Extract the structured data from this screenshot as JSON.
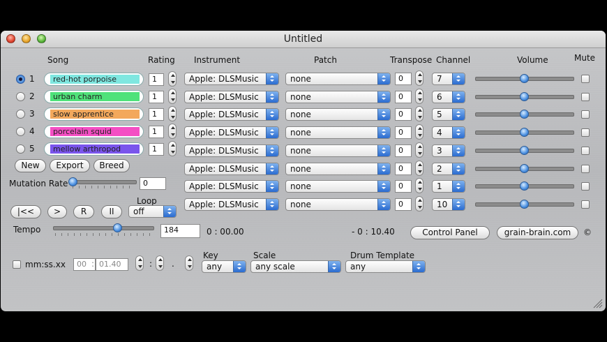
{
  "window": {
    "title": "Untitled"
  },
  "headers": {
    "song": "Song",
    "rating": "Rating",
    "instrument": "Instrument",
    "patch": "Patch",
    "transpose": "Transpose",
    "channel": "Channel",
    "volume": "Volume",
    "mute": "Mute"
  },
  "songs": [
    {
      "num": "1",
      "name": "red-hot porpoise",
      "color": "#7fe7e0",
      "rating": "1",
      "selected": true
    },
    {
      "num": "2",
      "name": "urban charm",
      "color": "#4fe27a",
      "rating": "1",
      "selected": false
    },
    {
      "num": "3",
      "name": "slow apprentice",
      "color": "#f3a85c",
      "rating": "1",
      "selected": false
    },
    {
      "num": "4",
      "name": "porcelain squid",
      "color": "#f44fc4",
      "rating": "1",
      "selected": false
    },
    {
      "num": "5",
      "name": "mellow arthropod",
      "color": "#7a55ec",
      "rating": "1",
      "selected": false
    }
  ],
  "tracks": [
    {
      "instrument": "Apple: DLSMusic",
      "patch": "none",
      "transpose": "0",
      "channel": "7",
      "volume": 0.5,
      "mute": false
    },
    {
      "instrument": "Apple: DLSMusic",
      "patch": "none",
      "transpose": "0",
      "channel": "6",
      "volume": 0.5,
      "mute": false
    },
    {
      "instrument": "Apple: DLSMusic",
      "patch": "none",
      "transpose": "0",
      "channel": "5",
      "volume": 0.5,
      "mute": false
    },
    {
      "instrument": "Apple: DLSMusic",
      "patch": "none",
      "transpose": "0",
      "channel": "4",
      "volume": 0.5,
      "mute": false
    },
    {
      "instrument": "Apple: DLSMusic",
      "patch": "none",
      "transpose": "0",
      "channel": "3",
      "volume": 0.5,
      "mute": false
    },
    {
      "instrument": "Apple: DLSMusic",
      "patch": "none",
      "transpose": "0",
      "channel": "2",
      "volume": 0.5,
      "mute": false
    },
    {
      "instrument": "Apple: DLSMusic",
      "patch": "none",
      "transpose": "0",
      "channel": "1",
      "volume": 0.5,
      "mute": false
    },
    {
      "instrument": "Apple: DLSMusic",
      "patch": "none",
      "transpose": "0",
      "channel": "10",
      "volume": 0.5,
      "mute": false
    }
  ],
  "buttons": {
    "new": "New",
    "export": "Export",
    "breed": "Breed",
    "rewind": "|<<",
    "play": ">",
    "record": "R",
    "pause": "II",
    "control_panel": "Control Panel",
    "website": "grain-brain.com",
    "copyright": "©"
  },
  "mutation": {
    "label": "Mutation Rate",
    "value": "0",
    "level": 0.0
  },
  "loop": {
    "label": "Loop",
    "value": "off"
  },
  "tempo": {
    "label": "Tempo",
    "value": "184",
    "level": 0.6
  },
  "time": {
    "elapsed": "0 : 00.00",
    "remaining": "-  0 : 10.40"
  },
  "timer": {
    "label": "mm:ss.xx",
    "minutes": "00",
    "seconds": "01.40",
    "colon": ":",
    "dot": "."
  },
  "key": {
    "label": "Key",
    "value": "any"
  },
  "scale": {
    "label": "Scale",
    "value": "any scale"
  },
  "drum": {
    "label": "Drum Template",
    "value": "any"
  },
  "colors": {
    "accent": "#2a6bd0"
  }
}
